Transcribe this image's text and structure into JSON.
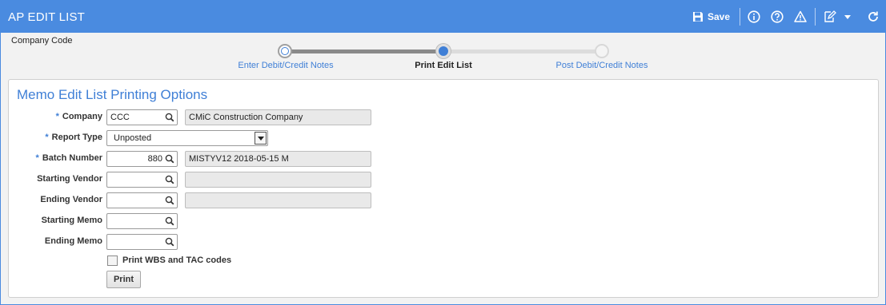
{
  "window": {
    "title": "AP EDIT LIST"
  },
  "toolbar": {
    "save_label": "Save",
    "icons": [
      "save-icon",
      "info-icon",
      "help-icon",
      "warning-icon",
      "edit-icon",
      "dropdown-arrow-icon",
      "refresh-icon"
    ]
  },
  "header": {
    "company_code_label": "Company Code"
  },
  "wizard": {
    "steps": [
      {
        "label": "Enter Debit/Credit Notes",
        "state": "completed"
      },
      {
        "label": "Print Edit List",
        "state": "current"
      },
      {
        "label": "Post Debit/Credit Notes",
        "state": "pending"
      }
    ]
  },
  "panel": {
    "title": "Memo Edit List Printing Options",
    "fields": {
      "company": {
        "label": "Company",
        "required": "*",
        "value": "CCC",
        "description": "CMiC Construction Company"
      },
      "report_type": {
        "label": "Report Type",
        "required": "*",
        "value": "Unposted"
      },
      "batch_number": {
        "label": "Batch Number",
        "required": "*",
        "value": "880",
        "description": "MISTYV12 2018-05-15 M"
      },
      "starting_vendor": {
        "label": "Starting Vendor",
        "value": "",
        "description": ""
      },
      "ending_vendor": {
        "label": "Ending Vendor",
        "value": "",
        "description": ""
      },
      "starting_memo": {
        "label": "Starting Memo",
        "value": ""
      },
      "ending_memo": {
        "label": "Ending Memo",
        "value": ""
      }
    },
    "checkbox": {
      "label": "Print WBS and TAC codes",
      "checked": false
    },
    "print_button": "Print"
  },
  "colors": {
    "title_bar": "#4a8be0",
    "accent": "#3f7fd6",
    "background": "#f2f2f2"
  }
}
